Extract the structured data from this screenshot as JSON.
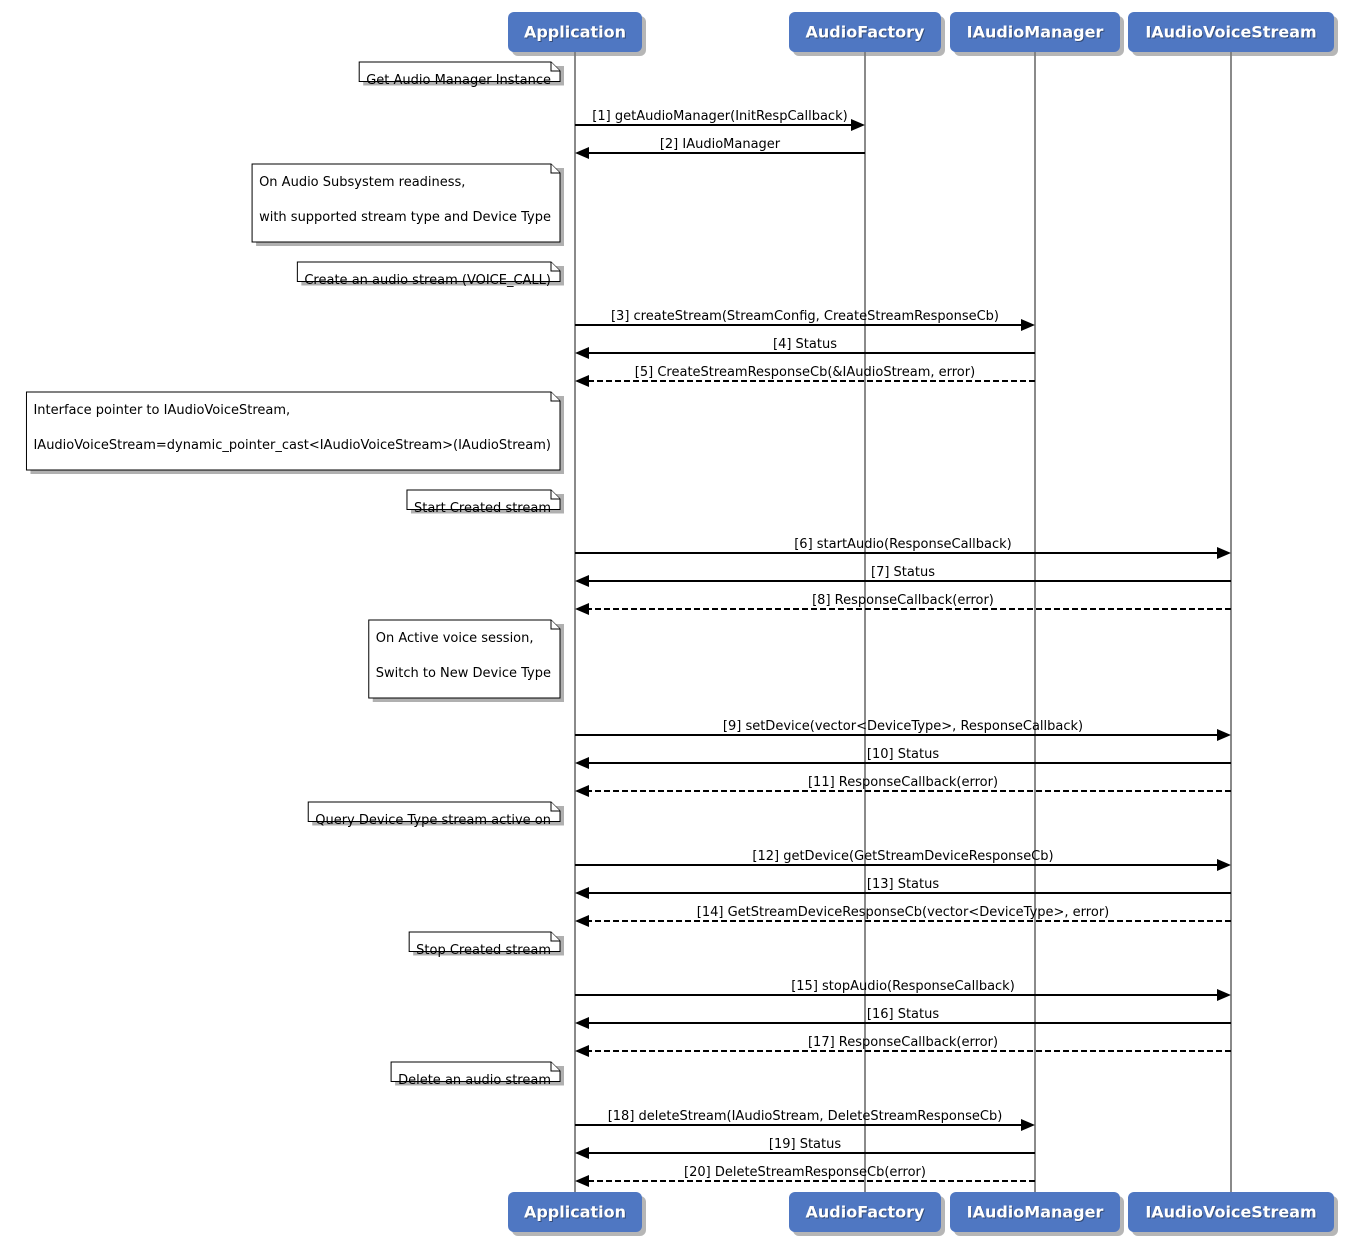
{
  "participants": [
    {
      "id": "app",
      "label": "Application"
    },
    {
      "id": "factory",
      "label": "AudioFactory"
    },
    {
      "id": "manager",
      "label": "IAudioManager"
    },
    {
      "id": "voice",
      "label": "IAudioVoiceStream"
    }
  ],
  "colors": {
    "participant_fill": "#4f77c2",
    "participant_text": "#ffffff",
    "lifeline": "#8a8a8a",
    "arrow": "#000000",
    "note_fill": "#ffffff"
  },
  "steps": [
    {
      "kind": "note",
      "lines": [
        "Get Audio Manager Instance"
      ]
    },
    {
      "kind": "msg",
      "label": "[1] getAudioManager(InitRespCallback)",
      "from": "app",
      "to": "factory",
      "style": "solid"
    },
    {
      "kind": "msg",
      "label": "[2] IAudioManager",
      "from": "factory",
      "to": "app",
      "style": "solid"
    },
    {
      "kind": "note",
      "lines": [
        "On Audio Subsystem readiness,",
        "",
        "with supported stream type and Device Type",
        ""
      ]
    },
    {
      "kind": "note",
      "lines": [
        "Create an audio stream (VOICE_CALL)"
      ]
    },
    {
      "kind": "msg",
      "label": "[3] createStream(StreamConfig, CreateStreamResponseCb)",
      "from": "app",
      "to": "manager",
      "style": "solid"
    },
    {
      "kind": "msg",
      "label": "[4] Status",
      "from": "manager",
      "to": "app",
      "style": "solid"
    },
    {
      "kind": "msg",
      "label": "[5] CreateStreamResponseCb(&IAudioStream, error)",
      "from": "manager",
      "to": "app",
      "style": "dashed"
    },
    {
      "kind": "note",
      "lines": [
        "Interface pointer to IAudioVoiceStream,",
        "",
        "IAudioVoiceStream=dynamic_pointer_cast<IAudioVoiceStream>(IAudioStream)",
        ""
      ]
    },
    {
      "kind": "note",
      "lines": [
        "Start Created stream"
      ]
    },
    {
      "kind": "msg",
      "label": "[6] startAudio(ResponseCallback)",
      "from": "app",
      "to": "voice",
      "style": "solid"
    },
    {
      "kind": "msg",
      "label": "[7] Status",
      "from": "voice",
      "to": "app",
      "style": "solid"
    },
    {
      "kind": "msg",
      "label": "[8] ResponseCallback(error)",
      "from": "voice",
      "to": "app",
      "style": "dashed"
    },
    {
      "kind": "note",
      "lines": [
        "On Active voice session,",
        "",
        "Switch to New Device Type",
        ""
      ]
    },
    {
      "kind": "msg",
      "label": "[9] setDevice(vector<DeviceType>, ResponseCallback)",
      "from": "app",
      "to": "voice",
      "style": "solid"
    },
    {
      "kind": "msg",
      "label": "[10] Status",
      "from": "voice",
      "to": "app",
      "style": "solid"
    },
    {
      "kind": "msg",
      "label": "[11] ResponseCallback(error)",
      "from": "voice",
      "to": "app",
      "style": "dashed"
    },
    {
      "kind": "note",
      "lines": [
        "Query Device Type stream active on"
      ]
    },
    {
      "kind": "msg",
      "label": "[12] getDevice(GetStreamDeviceResponseCb)",
      "from": "app",
      "to": "voice",
      "style": "solid"
    },
    {
      "kind": "msg",
      "label": "[13] Status",
      "from": "voice",
      "to": "app",
      "style": "solid"
    },
    {
      "kind": "msg",
      "label": "[14] GetStreamDeviceResponseCb(vector<DeviceType>, error)",
      "from": "voice",
      "to": "app",
      "style": "dashed"
    },
    {
      "kind": "note",
      "lines": [
        "Stop Created stream"
      ]
    },
    {
      "kind": "msg",
      "label": "[15] stopAudio(ResponseCallback)",
      "from": "app",
      "to": "voice",
      "style": "solid"
    },
    {
      "kind": "msg",
      "label": "[16] Status",
      "from": "voice",
      "to": "app",
      "style": "solid"
    },
    {
      "kind": "msg",
      "label": "[17] ResponseCallback(error)",
      "from": "voice",
      "to": "app",
      "style": "dashed"
    },
    {
      "kind": "note",
      "lines": [
        "Delete an audio stream"
      ]
    },
    {
      "kind": "msg",
      "label": "[18] deleteStream(IAudioStream, DeleteStreamResponseCb)",
      "from": "app",
      "to": "manager",
      "style": "solid"
    },
    {
      "kind": "msg",
      "label": "[19] Status",
      "from": "manager",
      "to": "app",
      "style": "solid"
    },
    {
      "kind": "msg",
      "label": "[20] DeleteStreamResponseCb(error)",
      "from": "manager",
      "to": "app",
      "style": "dashed"
    }
  ]
}
